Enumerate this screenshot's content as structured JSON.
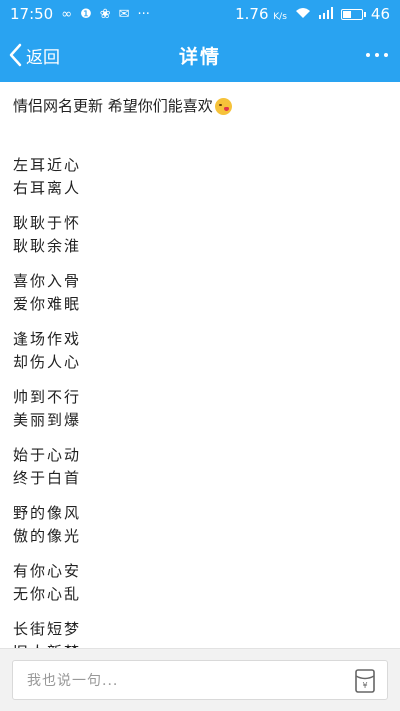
{
  "status_bar": {
    "time": "17:50",
    "signal_text": "1.76",
    "signal_unit": "K/s",
    "battery_level": "46"
  },
  "nav": {
    "back_label": "返回",
    "title": "详情"
  },
  "post": {
    "title": "情侣网名更新  希望你们能喜欢",
    "verses": [
      [
        "左耳近心",
        "右耳离人"
      ],
      [
        "耿耿于怀",
        "耿耿余淮"
      ],
      [
        "喜你入骨",
        "爱你难眠"
      ],
      [
        "逢场作戏",
        "却伤人心"
      ],
      [
        "帅到不行",
        "美丽到爆"
      ],
      [
        "始于心动",
        "终于白首"
      ],
      [
        "野的像风",
        "傲的像光"
      ],
      [
        "有你心安",
        "无你心乱"
      ],
      [
        "长街短梦",
        "旧人新梦"
      ]
    ]
  },
  "comment": {
    "placeholder": "我也说一句..."
  },
  "colors": {
    "accent": "#29a3f1"
  }
}
